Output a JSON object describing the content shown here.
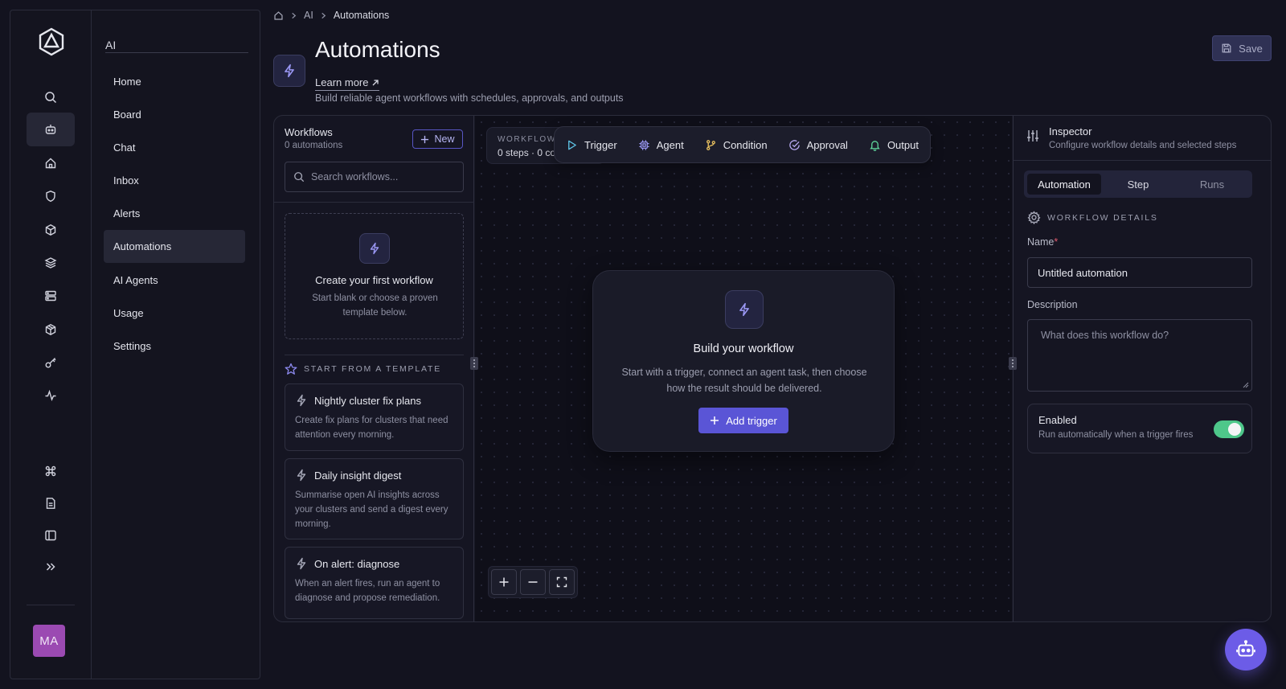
{
  "breadcrumb": {
    "items": [
      "AI",
      "Automations"
    ]
  },
  "sidebar": {
    "section_title": "AI",
    "items": [
      {
        "label": "Home",
        "active": false
      },
      {
        "label": "Board",
        "active": false
      },
      {
        "label": "Chat",
        "active": false
      },
      {
        "label": "Inbox",
        "active": false
      },
      {
        "label": "Alerts",
        "active": false
      },
      {
        "label": "Automations",
        "active": true
      },
      {
        "label": "AI Agents",
        "active": false
      },
      {
        "label": "Usage",
        "active": false
      },
      {
        "label": "Settings",
        "active": false
      }
    ],
    "rail_icons": [
      "search-icon",
      "bot-icon",
      "home-icon",
      "shield-icon",
      "cube-icon",
      "layers-icon",
      "server-icon",
      "package-icon",
      "key-icon",
      "activity-icon",
      "command-icon",
      "document-icon",
      "panel-icon",
      "expand-icon"
    ],
    "avatar_initials": "MA"
  },
  "header": {
    "title": "Automations",
    "learn_more": "Learn more",
    "subtitle": "Build reliable agent workflows with schedules, approvals, and outputs",
    "save_label": "Save"
  },
  "workflows": {
    "title": "Workflows",
    "count": "0 automations",
    "new_label": "New",
    "search_placeholder": "Search workflows...",
    "empty_title": "Create your first workflow",
    "empty_desc": "Start blank or choose a proven template below.",
    "templates_heading": "START FROM A TEMPLATE",
    "templates": [
      {
        "title": "Nightly cluster fix plans",
        "desc": "Create fix plans for clusters that need attention every morning."
      },
      {
        "title": "Daily insight digest",
        "desc": "Summarise open AI insights across your clusters and send a digest every morning."
      },
      {
        "title": "On alert: diagnose",
        "desc": "When an alert fires, run an agent to diagnose and propose remediation."
      }
    ]
  },
  "canvas": {
    "meta_label": "WORKFLOW",
    "meta_value": "0 steps · 0 co",
    "tools": [
      "Trigger",
      "Agent",
      "Condition",
      "Approval",
      "Output"
    ],
    "build_title": "Build your workflow",
    "build_desc": "Start with a trigger, connect an agent task, then choose how the result should be delivered.",
    "add_trigger_label": "Add trigger"
  },
  "inspector": {
    "title": "Inspector",
    "subtitle": "Configure workflow details and selected steps",
    "tabs": [
      "Automation",
      "Step",
      "Runs"
    ],
    "section_heading": "WORKFLOW DETAILS",
    "name_label": "Name",
    "name_required": "*",
    "name_value": "Untitled automation",
    "description_label": "Description",
    "description_placeholder": "What does this workflow do?",
    "enabled_label": "Enabled",
    "enabled_desc": "Run automatically when a trigger fires",
    "enabled": true
  },
  "colors": {
    "accent": "#5a55d6",
    "toggle_on": "#4ec78a",
    "avatar": "#9b4ab2",
    "background": "#13131f"
  }
}
